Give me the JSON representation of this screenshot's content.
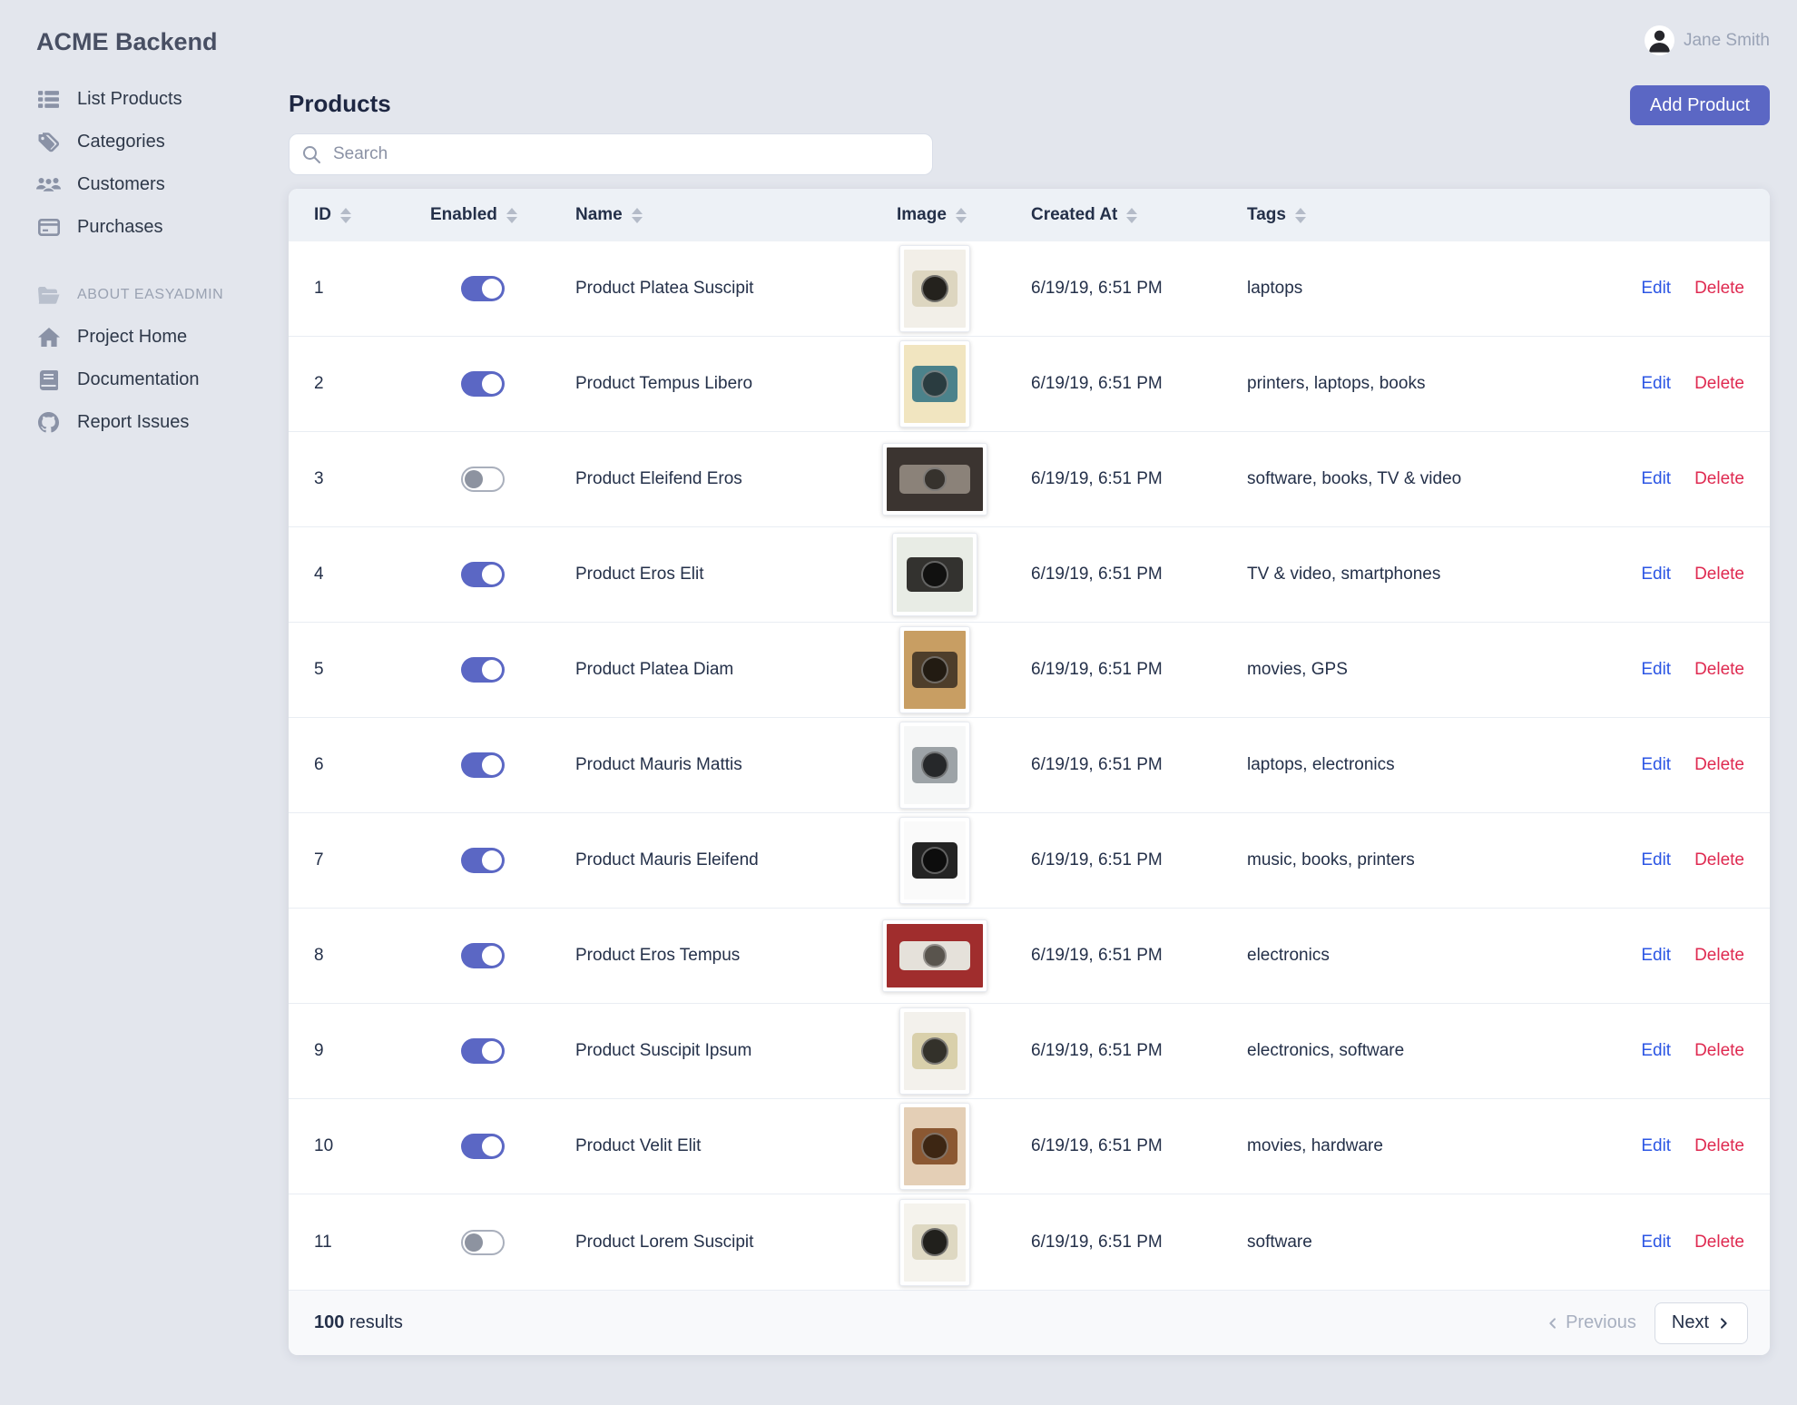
{
  "app": {
    "name": "ACME Backend"
  },
  "user": {
    "name": "Jane Smith",
    "avatar_icon": "person-icon"
  },
  "sidebar": {
    "menu": [
      {
        "label": "List Products",
        "icon": "table-list-icon"
      },
      {
        "label": "Categories",
        "icon": "tags-icon"
      },
      {
        "label": "Customers",
        "icon": "users-icon"
      },
      {
        "label": "Purchases",
        "icon": "credit-card-icon"
      }
    ],
    "section": {
      "label": "ABOUT EASYADMIN",
      "icon": "folder-open-icon"
    },
    "links": [
      {
        "label": "Project Home",
        "icon": "home-icon"
      },
      {
        "label": "Documentation",
        "icon": "book-icon"
      },
      {
        "label": "Report Issues",
        "icon": "github-icon"
      }
    ]
  },
  "main": {
    "title": "Products",
    "search_placeholder": "Search",
    "add_button": "Add Product"
  },
  "table": {
    "columns": [
      "ID",
      "Enabled",
      "Name",
      "Image",
      "Created At",
      "Tags"
    ],
    "edit_label": "Edit",
    "delete_label": "Delete",
    "rows": [
      {
        "id": "1",
        "enabled": true,
        "name": "Product Platea Suscipit",
        "created_at": "6/19/19, 6:51 PM",
        "tags": "laptops",
        "image": {
          "shape": "portrait",
          "photo_bg": "#f2efe8",
          "camera_color": "#ddd6c0",
          "lens_color": "#24221d"
        }
      },
      {
        "id": "2",
        "enabled": true,
        "name": "Product Tempus Libero",
        "created_at": "6/19/19, 6:51 PM",
        "tags": "printers, laptops, books",
        "image": {
          "shape": "portrait",
          "photo_bg": "#f1e5c0",
          "camera_color": "#4b828b",
          "lens_color": "#2a3c40"
        }
      },
      {
        "id": "3",
        "enabled": false,
        "name": "Product Eleifend Eros",
        "created_at": "6/19/19, 6:51 PM",
        "tags": "software, books, TV & video",
        "image": {
          "shape": "landscape",
          "photo_bg": "#3b3430",
          "camera_color": "#8b8279",
          "lens_color": "#36322d"
        }
      },
      {
        "id": "4",
        "enabled": true,
        "name": "Product Eros Elit",
        "created_at": "6/19/19, 6:51 PM",
        "tags": "TV & video, smartphones",
        "image": {
          "shape": "square",
          "photo_bg": "#e8ece5",
          "camera_color": "#33322f",
          "lens_color": "#111110"
        }
      },
      {
        "id": "5",
        "enabled": true,
        "name": "Product Platea Diam",
        "created_at": "6/19/19, 6:51 PM",
        "tags": "movies, GPS",
        "image": {
          "shape": "portrait",
          "photo_bg": "#c89e63",
          "camera_color": "#4e3e2b",
          "lens_color": "#221b12"
        }
      },
      {
        "id": "6",
        "enabled": true,
        "name": "Product Mauris Mattis",
        "created_at": "6/19/19, 6:51 PM",
        "tags": "laptops, electronics",
        "image": {
          "shape": "portrait",
          "photo_bg": "#f6f7f7",
          "camera_color": "#9da3a7",
          "lens_color": "#26282a"
        }
      },
      {
        "id": "7",
        "enabled": true,
        "name": "Product Mauris Eleifend",
        "created_at": "6/19/19, 6:51 PM",
        "tags": "music, books, printers",
        "image": {
          "shape": "portrait",
          "photo_bg": "#fafafa",
          "camera_color": "#242424",
          "lens_color": "#0d0d0d"
        }
      },
      {
        "id": "8",
        "enabled": true,
        "name": "Product Eros Tempus",
        "created_at": "6/19/19, 6:51 PM",
        "tags": "electronics",
        "image": {
          "shape": "landscape",
          "photo_bg": "#a02d2d",
          "camera_color": "#e5e1da",
          "lens_color": "#59544d"
        }
      },
      {
        "id": "9",
        "enabled": true,
        "name": "Product Suscipit Ipsum",
        "created_at": "6/19/19, 6:51 PM",
        "tags": "electronics, software",
        "image": {
          "shape": "portrait",
          "photo_bg": "#f3f1ec",
          "camera_color": "#d9d0ab",
          "lens_color": "#33312a"
        }
      },
      {
        "id": "10",
        "enabled": true,
        "name": "Product Velit Elit",
        "created_at": "6/19/19, 6:51 PM",
        "tags": "movies, hardware",
        "image": {
          "shape": "portrait",
          "photo_bg": "#e4cfb6",
          "camera_color": "#8b5832",
          "lens_color": "#3d2613"
        }
      },
      {
        "id": "11",
        "enabled": false,
        "name": "Product Lorem Suscipit",
        "created_at": "6/19/19, 6:51 PM",
        "tags": "software",
        "image": {
          "shape": "portrait",
          "photo_bg": "#f5f3ed",
          "camera_color": "#ded8c2",
          "lens_color": "#21201c"
        }
      }
    ]
  },
  "footer": {
    "results_count": "100",
    "results_label": "results",
    "previous_label": "Previous",
    "next_label": "Next"
  },
  "colors": {
    "accent": "#5b67c4",
    "edit_link": "#2c56e4",
    "delete_link": "#df2950",
    "toggle_on": "#5b67c4",
    "page_background": "#e3e6ed",
    "table_header_background": "#edf1f6"
  }
}
